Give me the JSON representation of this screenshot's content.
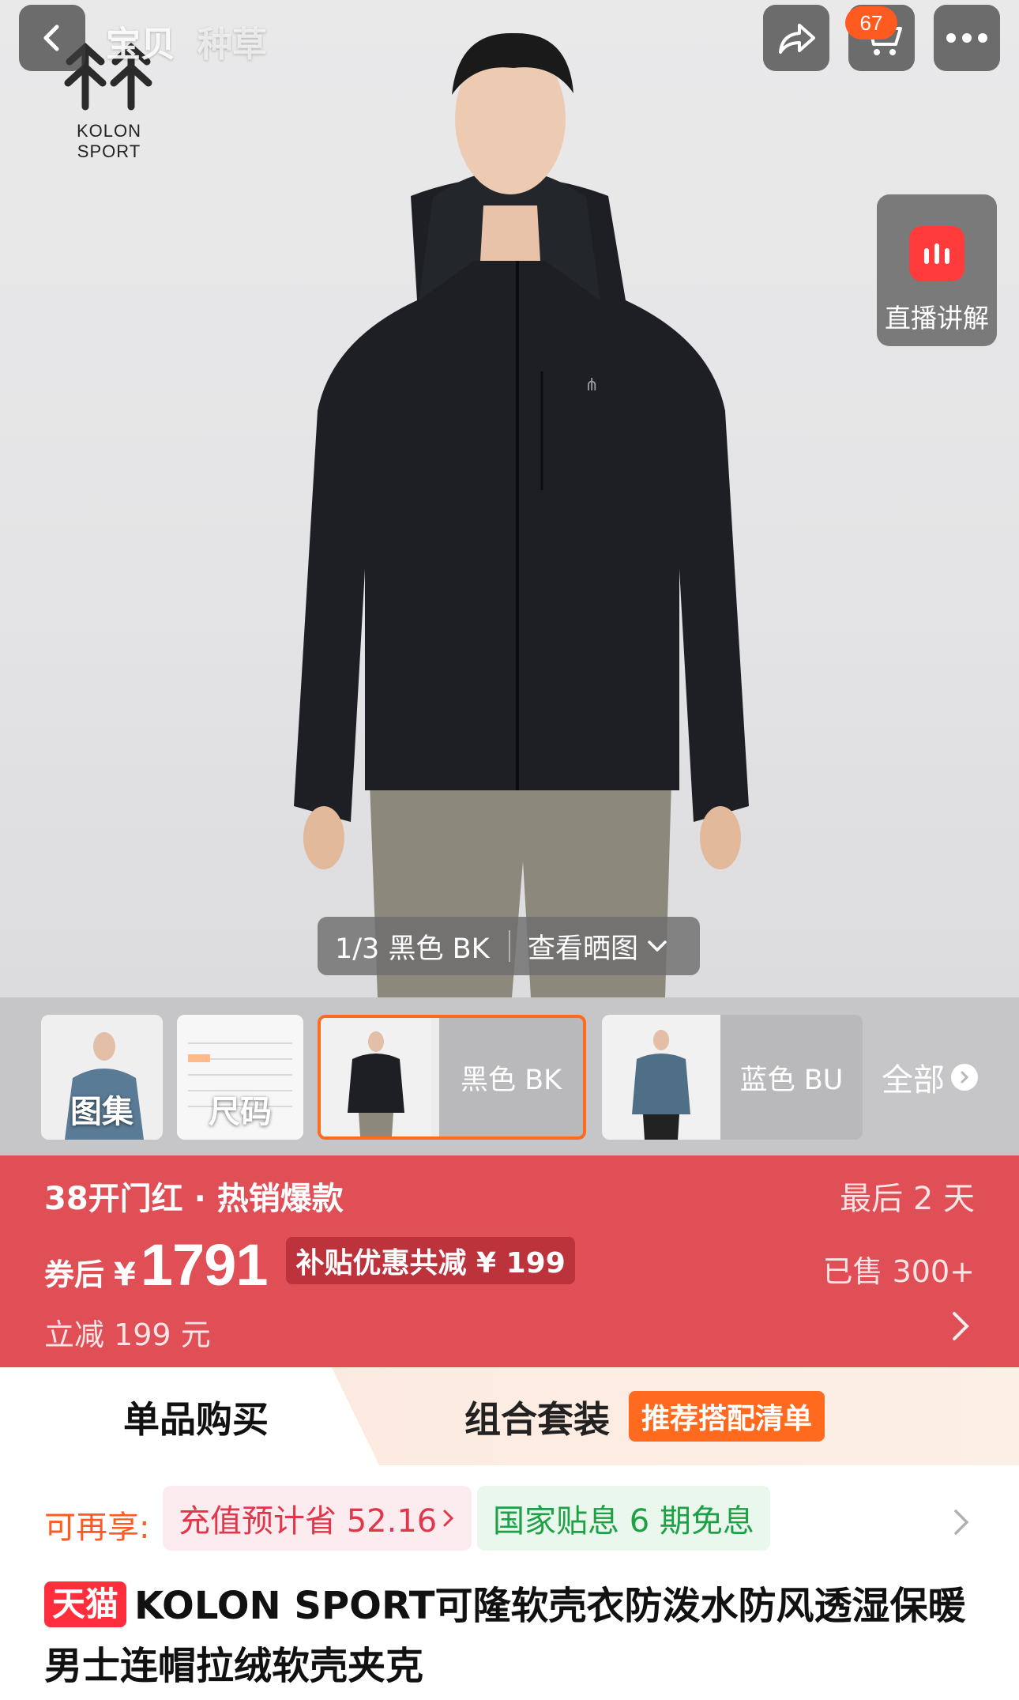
{
  "header": {
    "tabs": [
      "宝贝",
      "种草"
    ],
    "cart_count": "67",
    "brand_name": "KOLON SPORT"
  },
  "hero": {
    "live_label": "直播讲解",
    "image_counter": "1/3 黑色 BK",
    "view_photos_label": "查看晒图"
  },
  "thumbnails": {
    "atlas_label": "图集",
    "size_label": "尺码",
    "black_label": "黑色 BK",
    "blue_label": "蓝色 BU",
    "all_label": "全部"
  },
  "promo": {
    "title": "38开门红 · 热销爆款",
    "days_left": "最后 2 天",
    "price_prefix": "券后",
    "currency": "¥",
    "price": "1791",
    "subsidy": "补贴优惠共减 ¥ 199",
    "sold": "已售 300+",
    "instant_discount": "立减 199 元",
    "bg_color": "#e04e56"
  },
  "purchase": {
    "single_label": "单品购买",
    "combo_label": "组合套装",
    "combo_tag": "推荐搭配清单"
  },
  "benefits": {
    "label": "可再享:",
    "recharge": "充值预计省 52.16",
    "interest_free": "国家贴息 6 期免息"
  },
  "product": {
    "platform_badge": "天猫",
    "title": "KOLON SPORT可隆软壳衣防泼水防风透湿保暖男士连帽拉绒软壳夹克"
  }
}
